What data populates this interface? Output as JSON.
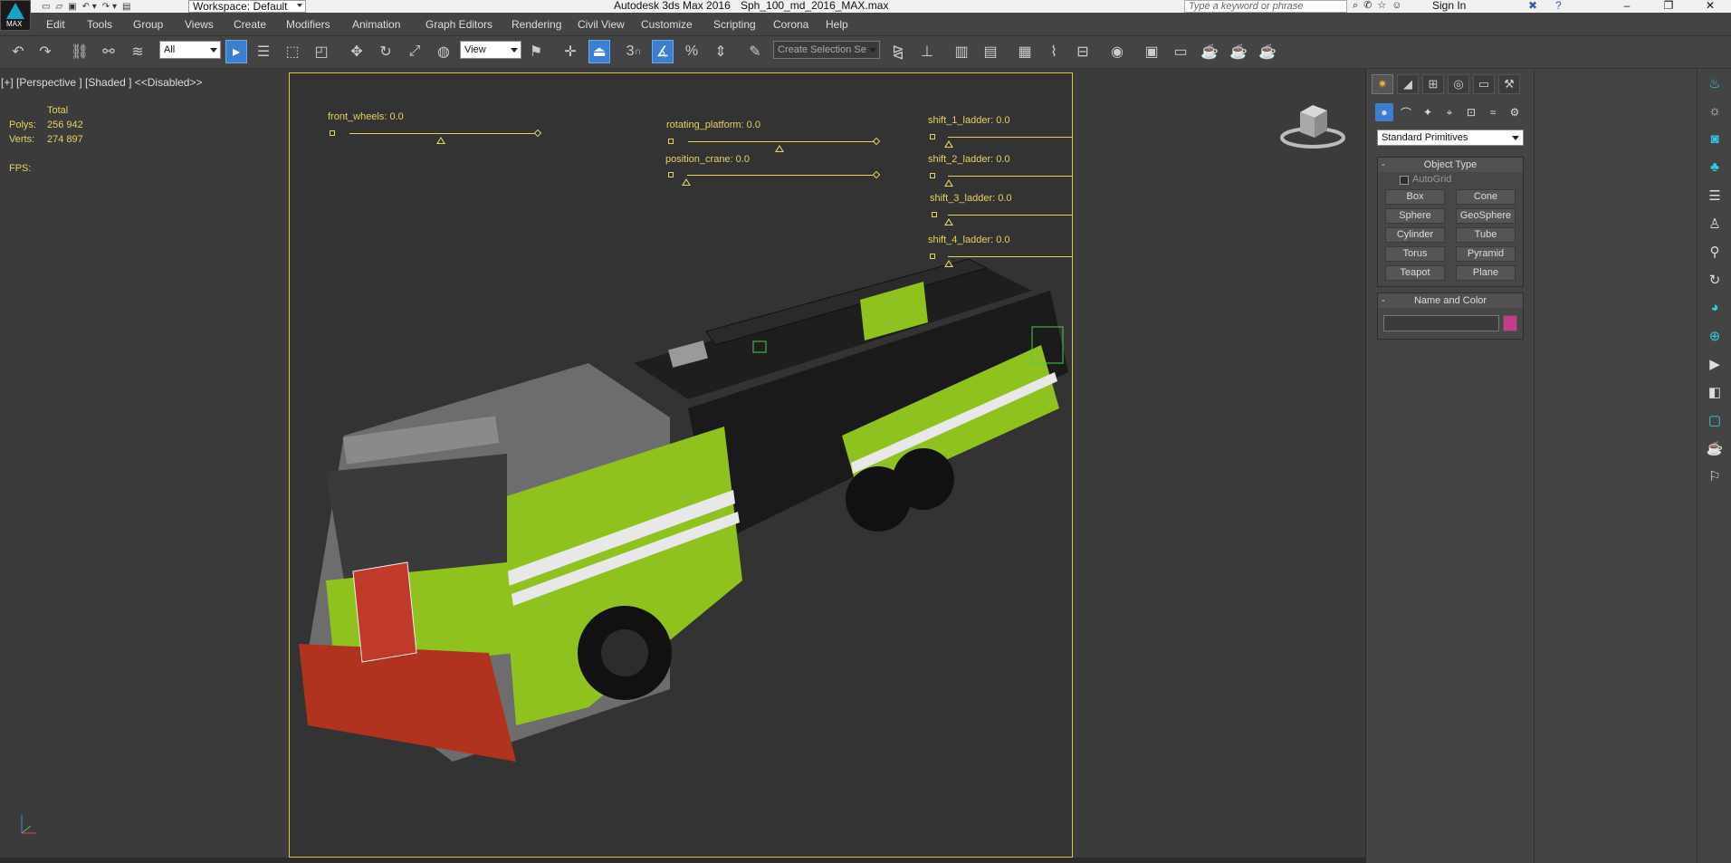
{
  "title": {
    "app": "Autodesk 3ds Max 2016",
    "file": "Sph_100_md_2016_MAX.max",
    "workspace": "Workspace: Default",
    "logo_text": "MAX",
    "search_placeholder": "Type a keyword or phrase",
    "sign_in": "Sign In",
    "icons": [
      "binoculars-icon",
      "satellite-icon",
      "star-icon",
      "user-icon",
      "x-icon",
      "help-icon"
    ]
  },
  "menu": [
    "Edit",
    "Tools",
    "Group",
    "Views",
    "Create",
    "Modifiers",
    "Animation",
    "Graph Editors",
    "Rendering",
    "Civil View",
    "Customize",
    "Scripting",
    "Corona",
    "Help"
  ],
  "toolbar": {
    "filter": "All",
    "ref_coord": "View",
    "snaps_label": "3",
    "named_selection_placeholder": "Create Selection Se"
  },
  "viewport": {
    "label": "[+] [Perspective ] [Shaded ]  <<Disabled>>",
    "stats": {
      "total_label": "Total",
      "polys_label": "Polys:",
      "polys_value": "256 942",
      "verts_label": "Verts:",
      "verts_value": "274 897",
      "fps_label": "FPS:"
    },
    "sliders": {
      "front_wheels": "front_wheels: 0.0",
      "rotating_platform": "rotating_platform: 0.0",
      "position_crane": "position_crane: 0.0",
      "shift_1_ladder": "shift_1_ladder: 0.0",
      "shift_2_ladder": "shift_2_ladder: 0.0",
      "shift_3_ladder": "shift_3_ladder: 0.0",
      "shift_4_ladder": "shift_4_ladder: 0.0"
    },
    "colors": {
      "frame": "#d8c64a",
      "slider": "#e8d063",
      "truck_green": "#8fc21f"
    }
  },
  "command_panel": {
    "tabs": [
      "create-icon",
      "modify-icon",
      "hierarchy-icon",
      "motion-icon",
      "display-icon",
      "utilities-icon"
    ],
    "category": "Standard Primitives",
    "object_type": {
      "header": "Object Type",
      "autogrid": "AutoGrid",
      "buttons": [
        "Box",
        "Cone",
        "Sphere",
        "GeoSphere",
        "Cylinder",
        "Tube",
        "Torus",
        "Pyramid",
        "Teapot",
        "Plane"
      ]
    },
    "name_and_color": {
      "header": "Name and Color",
      "color": "#c93a8a"
    }
  }
}
